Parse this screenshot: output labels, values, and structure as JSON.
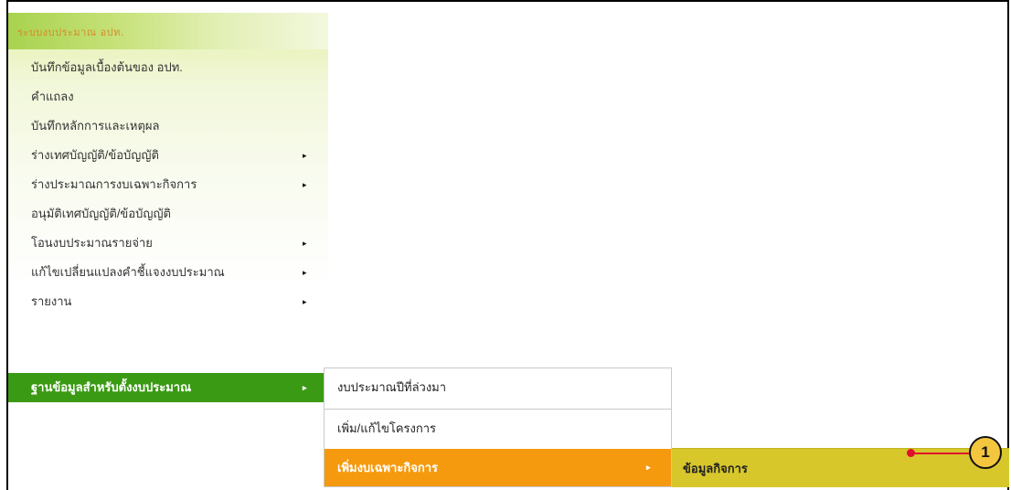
{
  "menu": {
    "header_title": "ระบบงบประมาณ อปท.",
    "items": [
      {
        "label": "บันทึกข้อมูลเบื้องต้นของ อปท.",
        "has_submenu": false
      },
      {
        "label": "คำแถลง",
        "has_submenu": false
      },
      {
        "label": "บันทึกหลักการและเหตุผล",
        "has_submenu": false
      },
      {
        "label": "ร่างเทศบัญญัติ/ข้อบัญญัติ",
        "has_submenu": true
      },
      {
        "label": "ร่างประมาณการงบเฉพาะกิจการ",
        "has_submenu": true
      },
      {
        "label": "อนุมัติเทศบัญญัติ/ข้อบัญญัติ",
        "has_submenu": false
      },
      {
        "label": "โอนงบประมาณรายจ่าย",
        "has_submenu": true
      },
      {
        "label": "แก้ไขเปลี่ยนแปลงคำชี้แจงงบประมาณ",
        "has_submenu": true
      },
      {
        "label": "รายงาน",
        "has_submenu": true
      },
      {
        "label": "ฐานข้อมูลสำหรับตั้งงบประมาณ",
        "has_submenu": true,
        "active": true
      }
    ],
    "arrow_glyph": "▸"
  },
  "submenu1": {
    "items": [
      {
        "label": "งบประมาณปีที่ล่วงมา"
      },
      {
        "label": "เพิ่ม/แก้ไขโครงการ"
      },
      {
        "label": "เพิ่มงบเฉพาะกิจการ",
        "highlighted": true
      }
    ]
  },
  "submenu2": {
    "items": [
      {
        "label": "ข้อมูลกิจการ"
      }
    ]
  },
  "callout": {
    "number": "1"
  },
  "colors": {
    "active_green": "#3b9a14",
    "highlight_orange": "#f59a0e",
    "submenu2_yellow": "#d7c72b",
    "callout_red": "#e0102c",
    "badge_yellow": "#f4c63d"
  }
}
